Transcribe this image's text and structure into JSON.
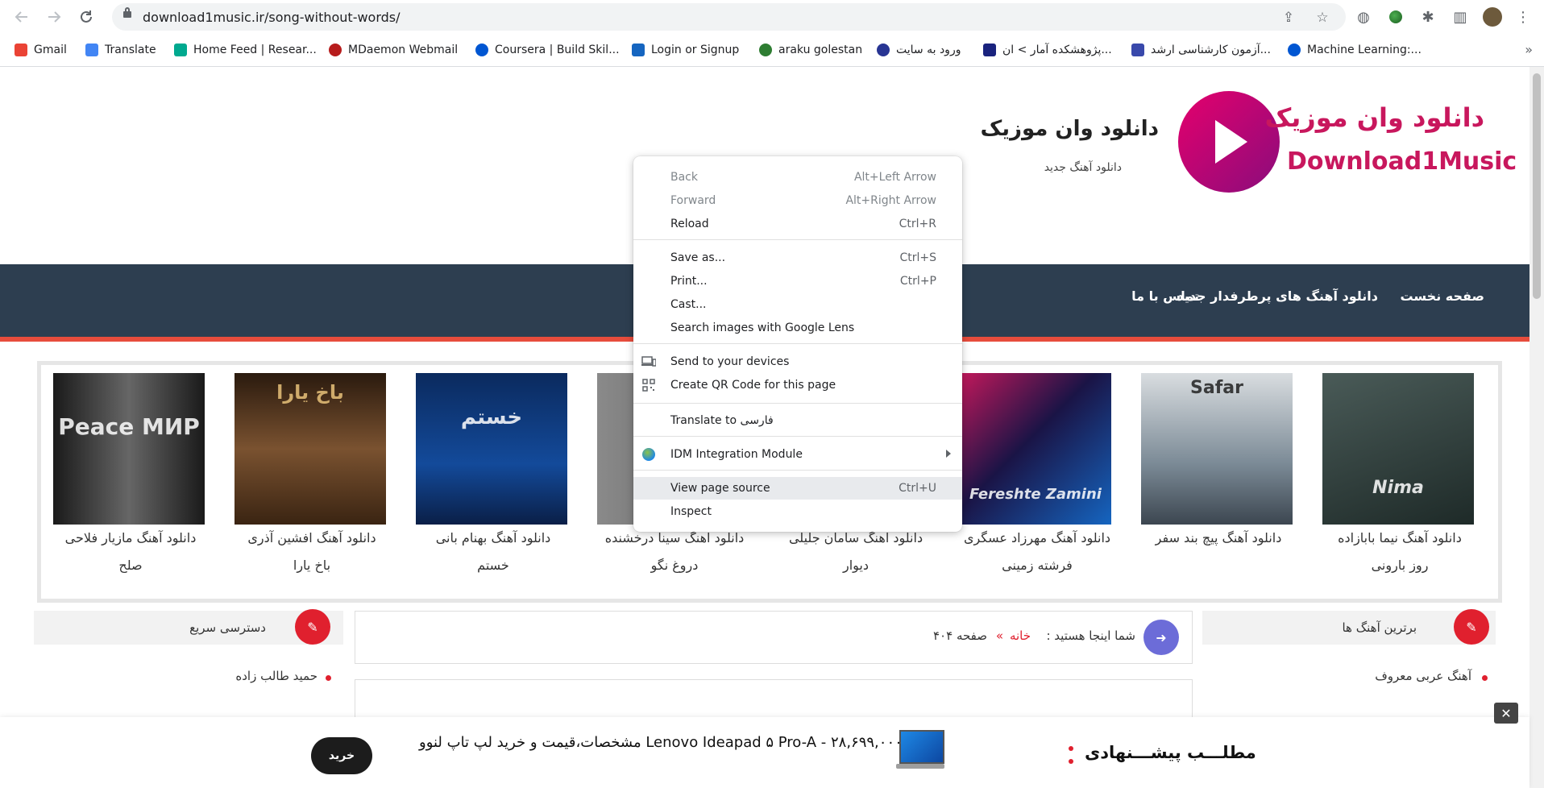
{
  "browser": {
    "url": "download1music.ir/song-without-words/",
    "bookmarks": [
      {
        "label": "Gmail",
        "color": "#ea4335"
      },
      {
        "label": "Translate",
        "color": "#4285f4"
      },
      {
        "label": "Home Feed | Resear...",
        "color": "#00a98f"
      },
      {
        "label": "MDaemon Webmail",
        "color": "#b71c1c"
      },
      {
        "label": "Coursera | Build Skil...",
        "color": "#0056d2"
      },
      {
        "label": "Login or Signup",
        "color": "#1565c0"
      },
      {
        "label": "araku golestan",
        "color": "#2e7d32"
      },
      {
        "label": "ورود به سایت",
        "color": "#283593"
      },
      {
        "label": "پژوهشکده آمار > ان...",
        "color": "#1a237e"
      },
      {
        "label": "آزمون کارشناسی ارشد...",
        "color": "#3949ab"
      },
      {
        "label": "Machine Learning:...",
        "color": "#0056d2"
      }
    ],
    "more_bookmarks": "»"
  },
  "site": {
    "title": "دانلود وان موزیک",
    "subtitle": "دانلود آهنگ جدید",
    "logo_fa": "دانلود وان موزیک",
    "logo_en": "Download1Music",
    "nav": [
      "صفحه نخست",
      "دانلود آهنگ های پرطرفدار جدید",
      "تماس با ما"
    ],
    "accent": "#e74c3c",
    "nav_bg": "#2d3e50"
  },
  "carousel": [
    {
      "line1": "دانلود آهنگ نیما بابازاده",
      "line2": "روز بارونی",
      "cover_text": "Nima",
      "color": "#2f3f3c"
    },
    {
      "line1": "دانلود آهنگ پیچ بند سفر",
      "line2": "",
      "cover_text": "Safar",
      "color": "#8a9aa6"
    },
    {
      "line1": "دانلود آهنگ مهرزاد عسگری",
      "line2": "فرشته زمینی",
      "cover_text": "Fereshte Zamini",
      "color": "#2a1f4a"
    },
    {
      "line1": "دانلود آهنگ سامان جلیلی",
      "line2": "دیوار",
      "cover_text": "",
      "color": "#3a2e4a"
    },
    {
      "line1": "دانلود آهنگ سینا درخشنده",
      "line2": "دروغ نگو",
      "cover_text": "",
      "color": "#7a7a7a"
    },
    {
      "line1": "دانلود آهنگ بهنام بانی",
      "line2": "خستم",
      "cover_text": "خستم",
      "color": "#0f2e66"
    },
    {
      "line1": "دانلود آهنگ افشین آذری",
      "line2": "باخ یارا",
      "cover_text": "باخ یارا",
      "color": "#5a3a22"
    },
    {
      "line1": "دانلود آهنگ مازیار فلاحی",
      "line2": "صلح",
      "cover_text": "Peace МИР",
      "color": "#3b3b3b"
    }
  ],
  "breadcrumb": {
    "prefix": "شما اینجا هستید :",
    "home": "خانه",
    "sep": "»",
    "current": "صفحه ۴۰۴"
  },
  "left_panel": {
    "title": "دسترسی سریع",
    "items": [
      "حمید طالب زاده"
    ]
  },
  "right_panel": {
    "title": "برترین آهنگ ها",
    "items": [
      "آهنگ عربی معروف"
    ]
  },
  "banner": {
    "buy_label": "خرید",
    "promo_text": "مشخصات،قیمت و خرید لپ تاپ لنوو Lenovo Ideapad ۵ Pro-A - ۲۸,۶۹۹,۰۰۰",
    "suggest_label": "مطلـــب پیشـــنهادی",
    "close": "✕"
  },
  "context_menu": {
    "groups": [
      [
        {
          "label": "Back",
          "shortcut": "Alt+Left Arrow",
          "disabled": true
        },
        {
          "label": "Forward",
          "shortcut": "Alt+Right Arrow",
          "disabled": true
        },
        {
          "label": "Reload",
          "shortcut": "Ctrl+R"
        }
      ],
      [
        {
          "label": "Save as...",
          "shortcut": "Ctrl+S"
        },
        {
          "label": "Print...",
          "shortcut": "Ctrl+P"
        },
        {
          "label": "Cast..."
        },
        {
          "label": "Search images with Google Lens"
        }
      ],
      [
        {
          "label": "Send to your devices",
          "icon": "devices-icon"
        },
        {
          "label": "Create QR Code for this page",
          "icon": "qr-code-icon"
        }
      ],
      [
        {
          "label": "Translate to فارسی"
        }
      ],
      [
        {
          "label": "IDM Integration Module",
          "icon": "idm-icon",
          "submenu": true
        }
      ],
      [
        {
          "label": "View page source",
          "shortcut": "Ctrl+U",
          "highlighted": true
        },
        {
          "label": "Inspect"
        }
      ]
    ]
  }
}
